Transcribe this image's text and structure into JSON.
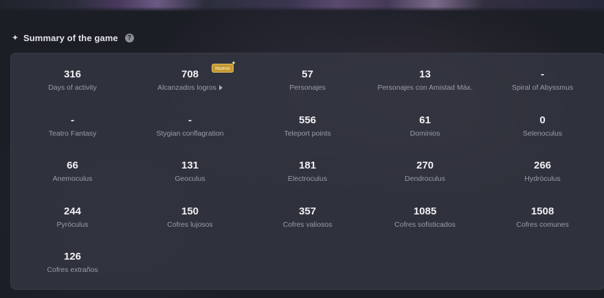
{
  "section": {
    "title": "Summary of the game",
    "help_symbol": "?",
    "sparkle_symbol": "✦",
    "help_icon": "question-circle-icon",
    "sparkle_icon": "sparkle-icon"
  },
  "badge": {
    "label": "Nuevo",
    "star": "✦"
  },
  "colors": {
    "badge_bg": "#c4972f",
    "value_text": "#f1f1f4",
    "label_text": "#9b9eaa"
  },
  "stats": [
    {
      "value": "316",
      "label": "Days of activity"
    },
    {
      "value": "708",
      "label": "Alcanzados logros"
    },
    {
      "value": "57",
      "label": "Personajes"
    },
    {
      "value": "13",
      "label": "Personajes con Amistad Máx."
    },
    {
      "value": "-",
      "label": "Spiral of Abyssmus"
    },
    {
      "value": "-",
      "label": "Teatro Fantasy"
    },
    {
      "value": "-",
      "label": "Stygian conflagration"
    },
    {
      "value": "556",
      "label": "Teleport points"
    },
    {
      "value": "61",
      "label": "Dominios"
    },
    {
      "value": "0",
      "label": "Selenoculus"
    },
    {
      "value": "66",
      "label": "Anemoculus"
    },
    {
      "value": "131",
      "label": "Geoculus"
    },
    {
      "value": "181",
      "label": "Electroculus"
    },
    {
      "value": "270",
      "label": "Dendroculus"
    },
    {
      "value": "266",
      "label": "Hydróculus"
    },
    {
      "value": "244",
      "label": "Pyróculus"
    },
    {
      "value": "150",
      "label": "Cofres lujosos"
    },
    {
      "value": "357",
      "label": "Cofres valiosos"
    },
    {
      "value": "1085",
      "label": "Cofres sofisticados"
    },
    {
      "value": "1508",
      "label": "Cofres comunes"
    },
    {
      "value": "126",
      "label": "Cofres extraños"
    }
  ]
}
